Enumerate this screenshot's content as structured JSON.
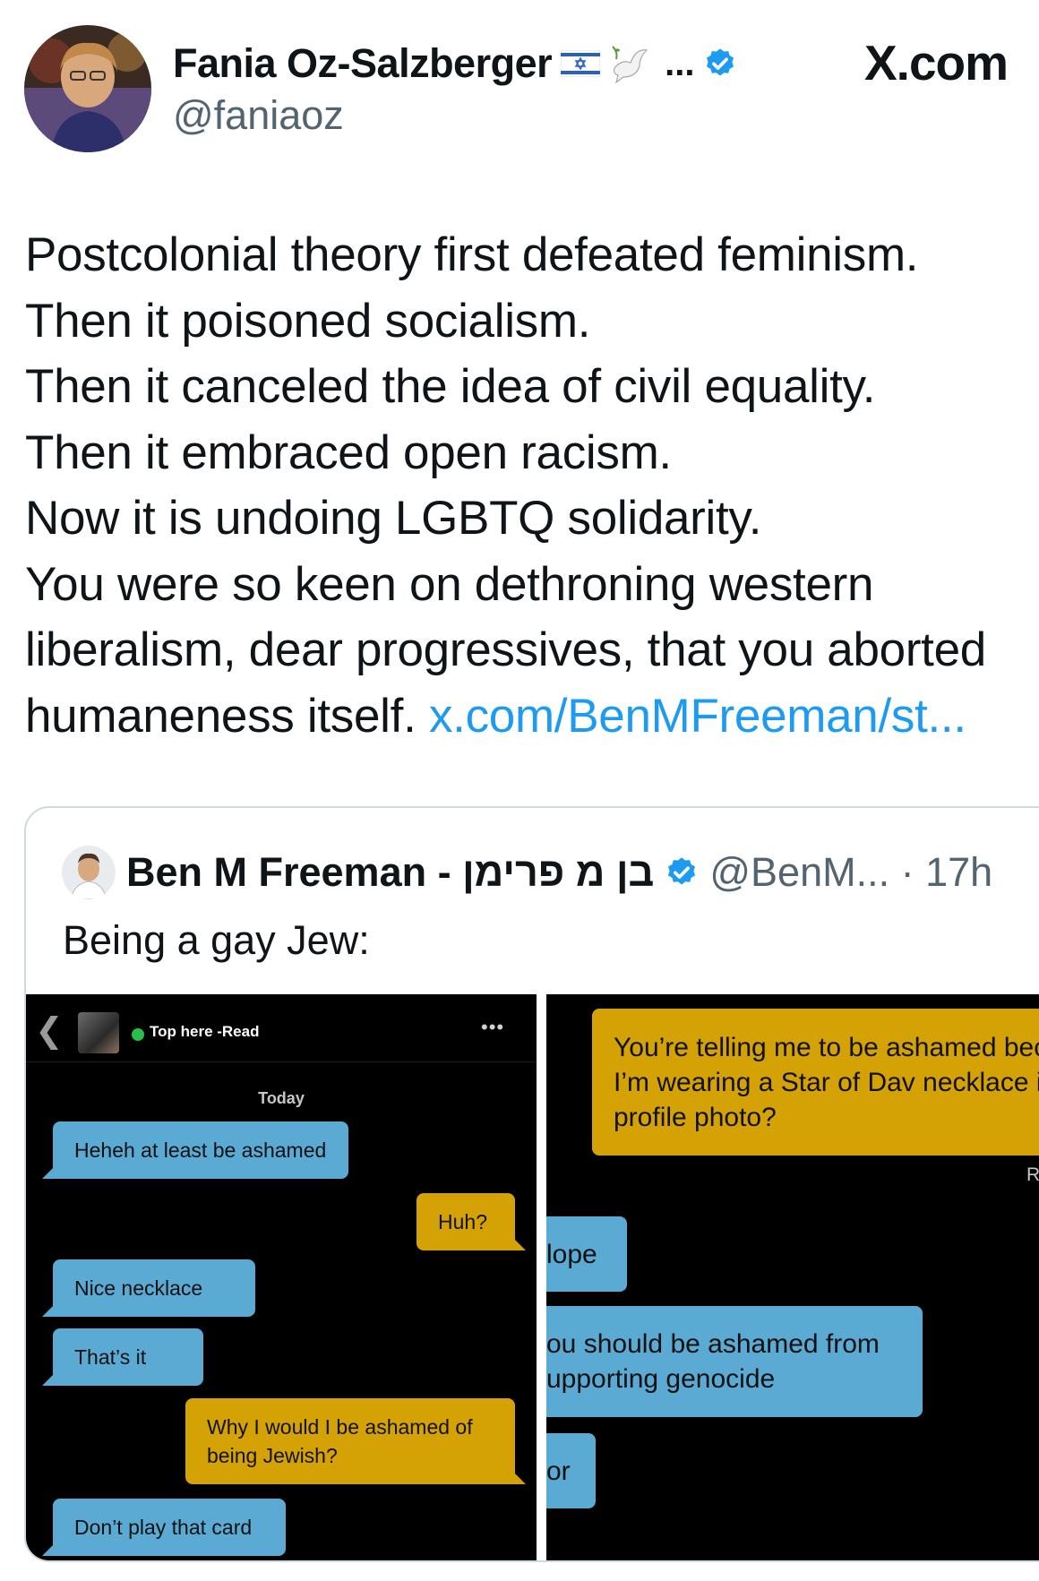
{
  "header": {
    "display_name": "Fania Oz-Salzberger",
    "name_overflow": "...",
    "handle": "@faniaoz",
    "site_label": "X.com"
  },
  "tweet": {
    "lines": [
      "Postcolonial theory first defeated feminism.",
      "Then it poisoned socialism.",
      "Then it canceled the idea of civil equality.",
      "Then it embraced open racism.",
      "Now it is undoing LGBTQ solidarity.",
      "You were so keen on dethroning western",
      "liberalism, dear progressives, that you aborted",
      "humaneness itself."
    ],
    "link_text": "x.com/BenMFreeman/st..."
  },
  "quote": {
    "name": "Ben M Freeman - בן מ פרימן",
    "handle_time": "@BenM... · 17h",
    "text": "Being a gay Jew:"
  },
  "chat_left": {
    "status": "Top here -Read",
    "more": "•••",
    "date_label": "Today",
    "messages": [
      {
        "from": "them",
        "text": "Heheh at least be ashamed"
      },
      {
        "from": "me",
        "text": "Huh?"
      },
      {
        "from": "them",
        "text": "Nice necklace"
      },
      {
        "from": "them",
        "text": "That’s it"
      },
      {
        "from": "me",
        "text": "Why I would I be ashamed of being Jewish?"
      },
      {
        "from": "them",
        "text": "Don’t play that card"
      }
    ]
  },
  "chat_right": {
    "messages": [
      {
        "from": "me",
        "text": "You’re telling me to be ashamed because I’m wearing a Star of Dav necklace in my profile photo?"
      },
      {
        "from": "them",
        "text": "lope"
      },
      {
        "from": "them",
        "text": "ou should be ashamed from upporting genocide"
      },
      {
        "from": "them",
        "text": "or"
      }
    ],
    "read_label": "Rea"
  },
  "colors": {
    "link": "#1d9bf0",
    "verified": "#1d9bf0",
    "chat_blue": "#5aaad3",
    "chat_gold": "#d4a204",
    "chat_bg": "#000000"
  },
  "icons": [
    "avatar-photo",
    "israel-flag-icon",
    "dove-icon",
    "verified-badge-icon",
    "back-chevron-icon",
    "online-dot-icon",
    "more-dots-icon"
  ]
}
